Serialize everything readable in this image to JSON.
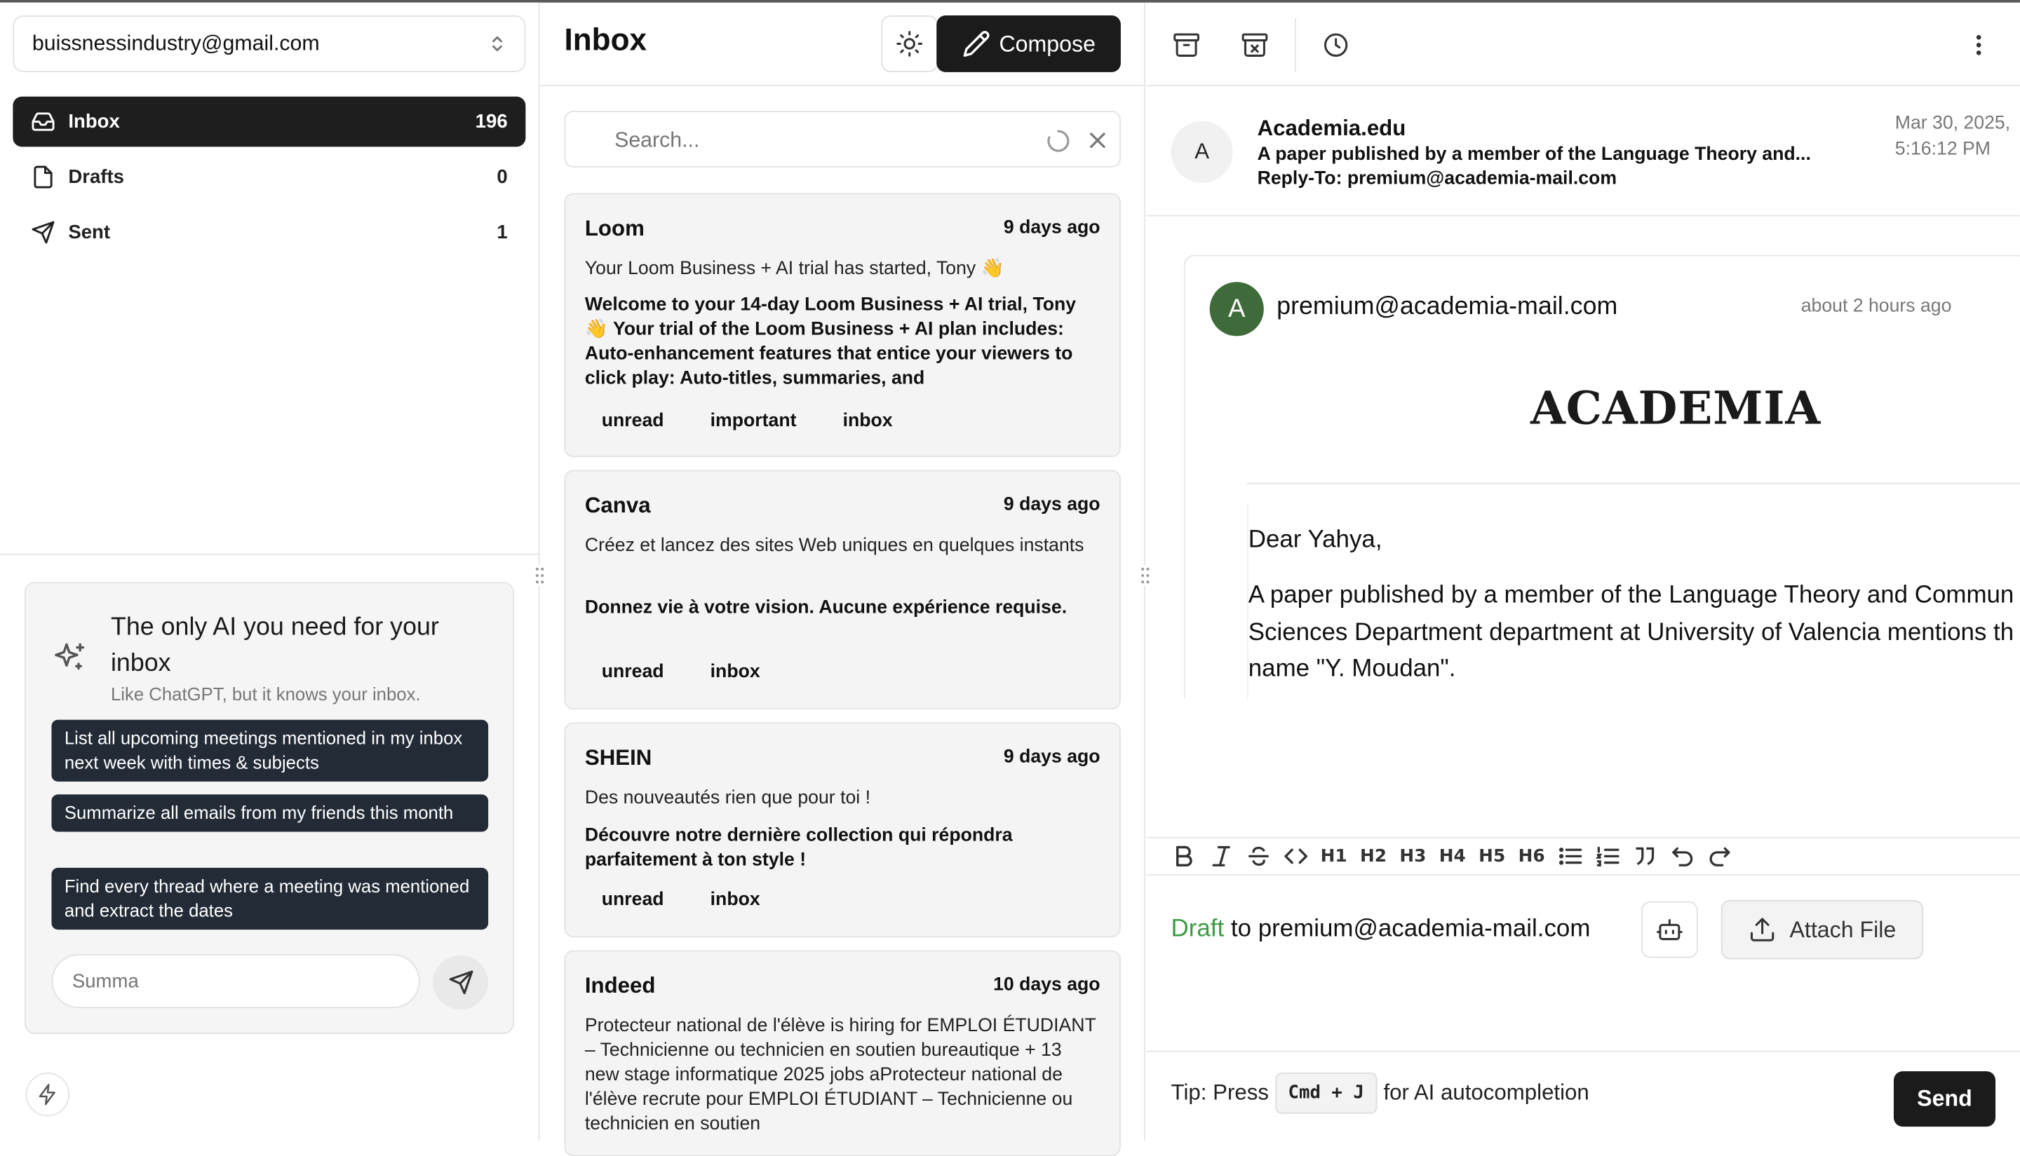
{
  "sidebar": {
    "account": "buissnessindustry@gmail.com",
    "nav": [
      {
        "label": "Inbox",
        "count": "196"
      },
      {
        "label": "Drafts",
        "count": "0"
      },
      {
        "label": "Sent",
        "count": "1"
      }
    ],
    "ai": {
      "title": "The only AI you need for your inbox",
      "subtitle": "Like ChatGPT, but it knows your inbox.",
      "suggestions": [
        "List all upcoming meetings mentioned in my inbox next week with times & subjects",
        "Summarize all emails from my friends this month",
        "Find every thread where a meeting was mentioned and extract the dates"
      ],
      "input_placeholder": "Summa"
    }
  },
  "inbox": {
    "title": "Inbox",
    "compose_label": "Compose",
    "search_placeholder": "Search...",
    "mails": [
      {
        "from": "Loom",
        "time": "9 days ago",
        "subject": "Your Loom Business + AI trial has started, Tony 👋",
        "preview": "Welcome to your 14-day Loom Business + AI trial, Tony 👋 Your trial of the Loom Business + AI plan includes: Auto-enhancement features that entice your viewers to click play: Auto-titles, summaries, and",
        "tags": [
          "unread",
          "important",
          "inbox"
        ]
      },
      {
        "from": "Canva",
        "time": "9 days ago",
        "subject": "Créez et lancez des sites Web uniques en quelques instants",
        "preview": "Donnez vie à votre vision. Aucune expérience requise.",
        "tags": [
          "unread",
          "inbox"
        ]
      },
      {
        "from": "SHEIN",
        "time": "9 days ago",
        "subject": "Des nouveautés rien que pour toi !",
        "preview": "Découvre notre dernière collection qui répondra parfaitement à ton style !",
        "tags": [
          "unread",
          "inbox"
        ]
      },
      {
        "from": "Indeed",
        "time": "10 days ago",
        "subject": "Protecteur national de l'élève is hiring for EMPLOI ÉTUDIANT – Technicienne ou technicien en soutien bureautique + 13 new stage informatique 2025 jobs aProtecteur national de l'élève recrute pour EMPLOI ÉTUDIANT – Technicienne ou technicien en soutien",
        "preview": "",
        "tags": []
      }
    ]
  },
  "reader": {
    "header": {
      "avatar": "A",
      "from": "Academia.edu",
      "subject": "A paper published by a member of the Language Theory and...",
      "reply_to": "Reply-To: premium@academia-mail.com",
      "date": "Mar 30, 2025, 5:16:12 PM"
    },
    "message": {
      "avatar": "A",
      "from": "premium@academia-mail.com",
      "ago": "about 2 hours ago",
      "logo": "ACADEMIA",
      "greeting": "Dear Yahya,",
      "body_lines": [
        "A paper published by a member of the Language Theory and Commun",
        "Sciences Department department at University of Valencia mentions th",
        "name \"Y. Moudan\"."
      ]
    },
    "editor": {
      "headings": [
        "H1",
        "H2",
        "H3",
        "H4",
        "H5",
        "H6"
      ],
      "draft_word": "Draft",
      "draft_to": " to premium@academia-mail.com",
      "attach_label": "Attach File",
      "tip_prefix": "Tip: Press",
      "tip_kbd": "Cmd + J",
      "tip_suffix": "for AI autocompletion",
      "send_label": "Send"
    }
  }
}
